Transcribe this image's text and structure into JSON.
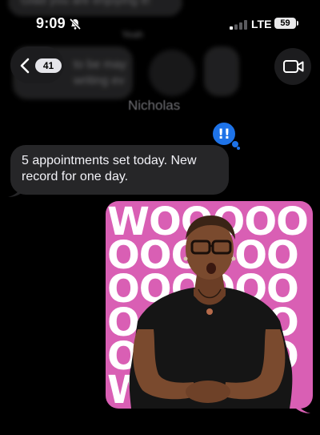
{
  "status_bar": {
    "time": "9:09",
    "network": "LTE",
    "battery_level": "59"
  },
  "header": {
    "unread_count": "41",
    "contact_name": "Nicholas",
    "blurred_messages": [
      "Glad you are enjoying it!",
      "Yeah",
      "to be may",
      "writing ev"
    ]
  },
  "messages": [
    {
      "direction": "incoming",
      "text": "5 appointments set today. New record for one day.",
      "tapback": "!!"
    },
    {
      "direction": "outgoing",
      "type": "gif",
      "gif_text": "WOOOOOOOOOOOOOOOOOOOOOOOW"
    }
  ],
  "colors": {
    "background": "#000000",
    "incoming_bubble": "#262628",
    "tapback": "#1e73e8",
    "gif_background": "#d95fb4"
  }
}
